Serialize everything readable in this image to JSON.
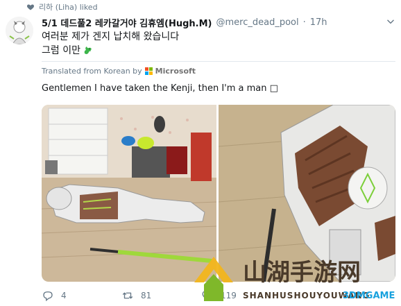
{
  "activity": {
    "liked_text": "리하 (Liha) liked",
    "icon": "heart-icon"
  },
  "tweet": {
    "display_name": "5/1 데드풀2 레카갈거야 김휴엠(Hugh.M)",
    "handle": "@merc_dead_pool",
    "separator": "·",
    "timestamp": "17h",
    "text_line1": "여러분 제가 겐지 납치해 왔습니다",
    "text_line2": "그럼 이만",
    "translated_prefix": "Translated from Korean by",
    "translator": "Microsoft",
    "translation": "Gentlemen I have taken the Kenji, then I'm a man □",
    "colors": {
      "ms_red": "#f25022",
      "ms_green": "#7fba00",
      "ms_blue": "#00a4ef",
      "ms_yellow": "#ffb900"
    }
  },
  "actions": {
    "replies": "4",
    "retweets": "81",
    "likes": "119"
  },
  "watermark": {
    "chinese": "山湖手游网",
    "pinyin": "SHANHUSHOUYOUWANG",
    "site": "3DMGAME"
  }
}
